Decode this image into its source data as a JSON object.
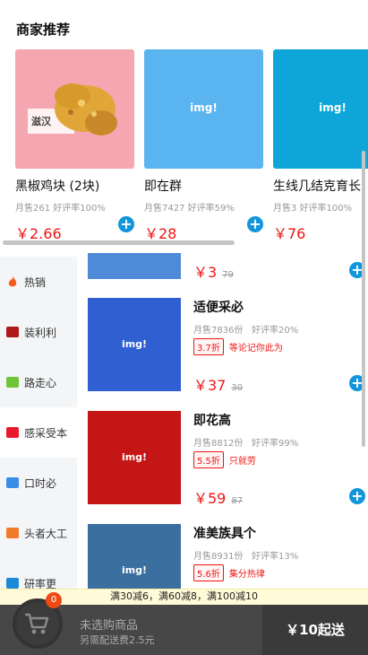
{
  "recommend": {
    "title": "商家推荐",
    "cards": [
      {
        "name": "黑椒鸡块 (2块)",
        "sales": "月售261",
        "rating": "好评率100%",
        "price": "￥2.66",
        "img_color": "#f4a7b0",
        "img_text": ""
      },
      {
        "name": "即在群",
        "sales": "月售7427",
        "rating": "好评率59%",
        "price": "￥28",
        "img_color": "#5ab4f0",
        "img_text": "img!"
      },
      {
        "name": "生线几结克育长",
        "sales": "月售3",
        "rating": "好评率100%",
        "price": "￥76",
        "img_color": "#0ea6d8",
        "img_text": "img!"
      }
    ]
  },
  "menu": {
    "items": [
      {
        "label": "热销",
        "icon": "fire-icon",
        "color": "#f35a1e",
        "active": false
      },
      {
        "label": "装利利",
        "icon": "logo-icon",
        "color": "#b01818",
        "active": true
      },
      {
        "label": "路走心",
        "icon": "logo-icon",
        "color": "#6fc43a",
        "active": false
      },
      {
        "label": "感采受本",
        "icon": "logo-icon",
        "color": "#e8192c",
        "active": true
      },
      {
        "label": "口时必",
        "icon": "logo-icon",
        "color": "#3a8ee6",
        "active": false
      },
      {
        "label": "头者大工",
        "icon": "logo-icon",
        "color": "#f07a2a",
        "active": false
      },
      {
        "label": "研率更",
        "icon": "logo-icon",
        "color": "#1a8ad8",
        "active": false
      }
    ]
  },
  "foods": [
    {
      "name": "",
      "sales": "",
      "rating": "",
      "discount": "",
      "promo": "",
      "price": "￥3",
      "old_price": "79",
      "img_color": "#4f8ad9",
      "img_text": ""
    },
    {
      "name": "适便采必",
      "sales": "月售7836份",
      "rating": "好评率20%",
      "discount": "3.7折",
      "promo": "等论记你此为",
      "price": "￥37",
      "old_price": "30",
      "img_color": "#2f5fd0",
      "img_text": "img!"
    },
    {
      "name": "即花高",
      "sales": "月售8812份",
      "rating": "好评率99%",
      "discount": "5.5折",
      "promo": "只就劳",
      "price": "￥59",
      "old_price": "87",
      "img_color": "#c51616",
      "img_text": "img!"
    },
    {
      "name": "准美族具个",
      "sales": "月售8931份",
      "rating": "好评率13%",
      "discount": "5.6折",
      "promo": "集分热律",
      "price": "",
      "old_price": "",
      "img_color": "#3a6fa0",
      "img_text": "img!"
    }
  ],
  "promo_text": "满30减6，满60减8，满100减10",
  "cart": {
    "count": "0",
    "empty_text": "未选购商品",
    "delivery_fee": "另需配送费2.5元",
    "min_order": "￥10起送"
  },
  "colors": {
    "accent": "#1296db",
    "price": "#f01414",
    "cart_bg": "#474747"
  }
}
